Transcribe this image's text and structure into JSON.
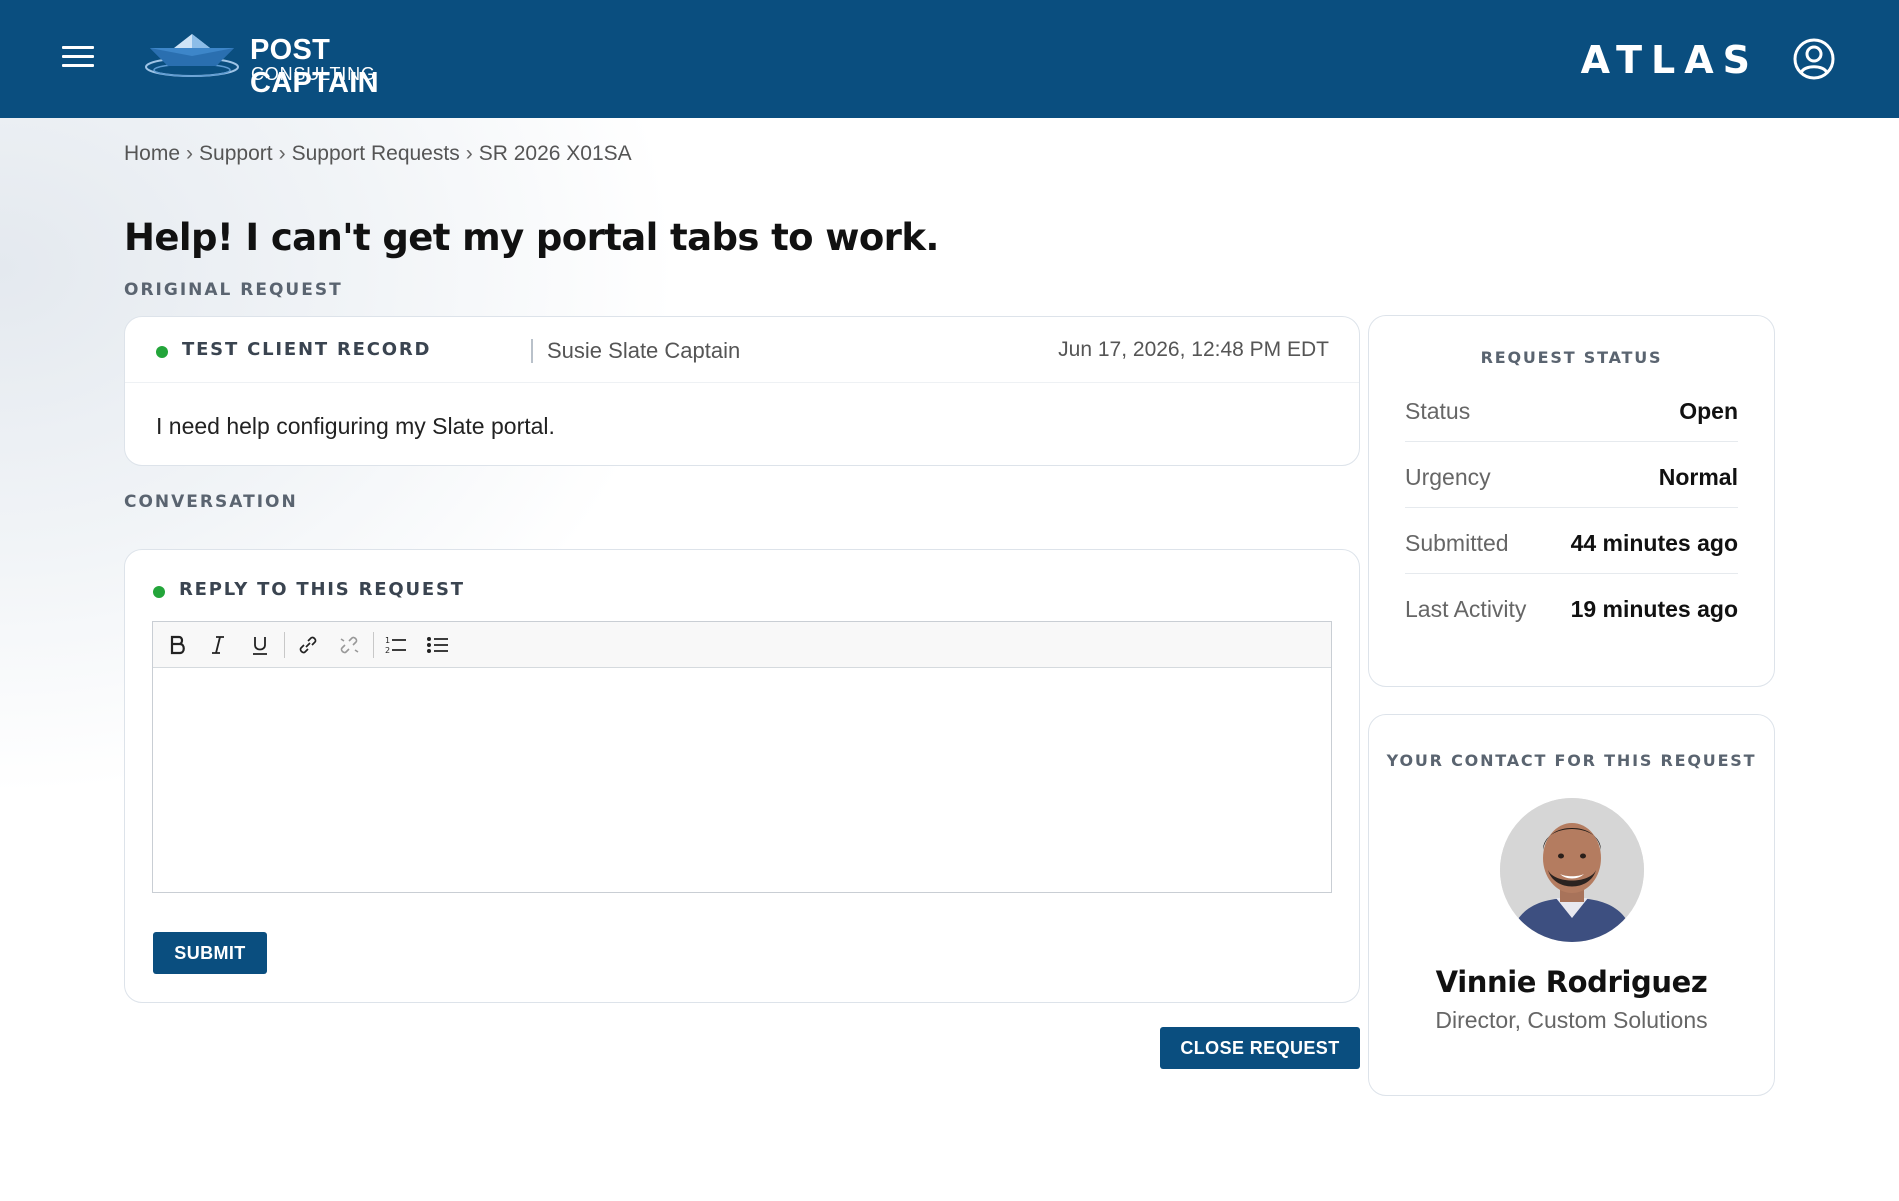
{
  "header": {
    "logo_line1": "POST CAPTAIN",
    "logo_line2": "CONSULTING",
    "brand": "ATLAS",
    "bg_color": "#0a4e7f"
  },
  "breadcrumb": [
    "Home",
    "Support",
    "Support Requests",
    "SR 2026 X01SA"
  ],
  "breadcrumb_sep": "›",
  "page_title": "Help! I can't get my portal tabs to work.",
  "original_request": {
    "section_label": "ORIGINAL REQUEST",
    "client_label": "TEST CLIENT RECORD",
    "client_name": "Susie Slate Captain",
    "date": "Jun 17, 2026, 12:48 PM EDT",
    "body": "I need help configuring my Slate portal."
  },
  "conversation": {
    "section_label": "CONVERSATION",
    "reply_label": "REPLY TO THIS REQUEST",
    "editor_value": "",
    "toolbar": [
      "bold-icon",
      "italic-icon",
      "underline-icon",
      "link-icon",
      "unlink-icon",
      "ordered-list-icon",
      "bullet-list-icon"
    ],
    "submit_label": "SUBMIT",
    "close_label": "CLOSE REQUEST"
  },
  "request_status": {
    "heading": "REQUEST STATUS",
    "rows": [
      {
        "key": "Status",
        "value": "Open"
      },
      {
        "key": "Urgency",
        "value": "Normal"
      },
      {
        "key": "Submitted",
        "value": "44 minutes ago"
      },
      {
        "key": "Last Activity",
        "value": "19 minutes ago"
      }
    ]
  },
  "contact": {
    "heading": "YOUR CONTACT FOR THIS REQUEST",
    "name": "Vinnie Rodriguez",
    "title": "Director, Custom Solutions"
  },
  "colors": {
    "accent": "#0a4e7f",
    "status_dot": "#23a53a"
  }
}
